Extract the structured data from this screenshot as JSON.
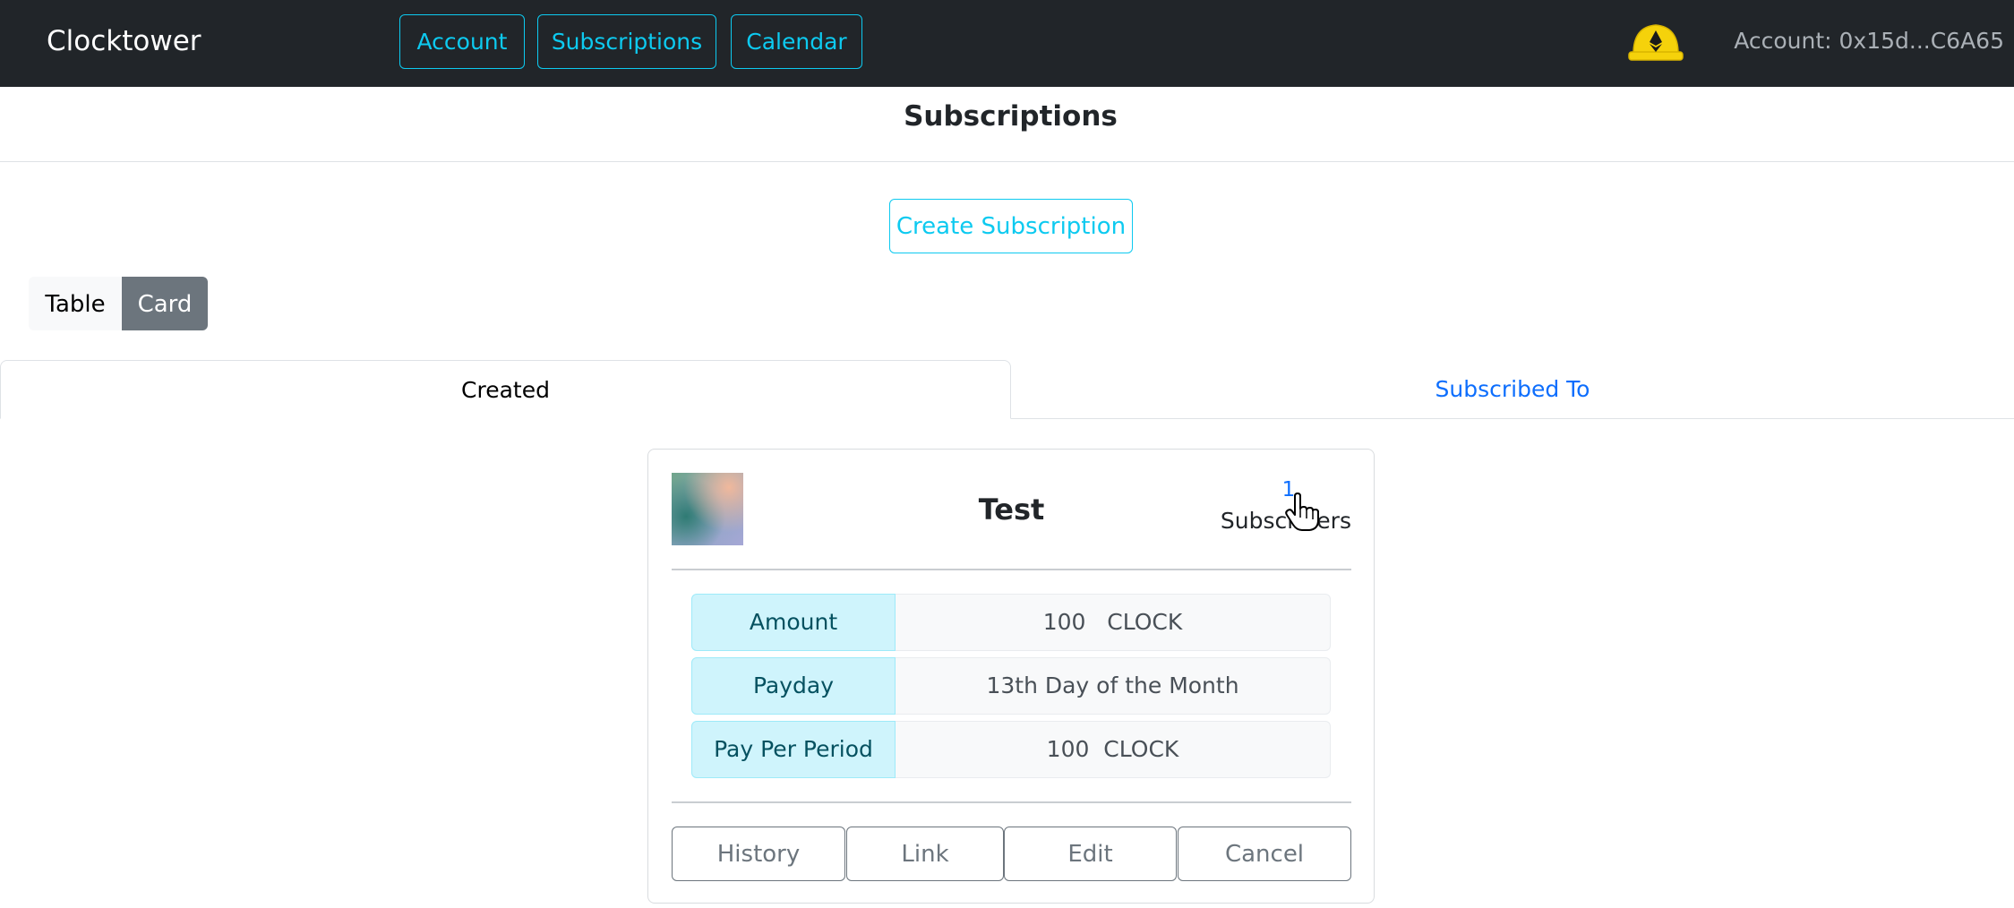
{
  "navbar": {
    "brand": "Clocktower",
    "links": {
      "account": "Account",
      "subscriptions": "Subscriptions",
      "calendar": "Calendar"
    },
    "wallet_icon": "ethereum-helmet-icon",
    "account_text": "Account: 0x15d...C6A65"
  },
  "page": {
    "title": "Subscriptions",
    "create_button": "Create Subscription"
  },
  "view_toggle": {
    "table": "Table",
    "card": "Card",
    "selected": "Card"
  },
  "tabs": {
    "created": "Created",
    "subscribed": "Subscribed To",
    "active": "Created"
  },
  "card": {
    "title": "Test",
    "subscriber_count": "1",
    "subscriber_label": "Subscribers",
    "rows": [
      {
        "label": "Amount",
        "value": "100   CLOCK"
      },
      {
        "label": "Payday",
        "value": "13th Day of the Month"
      },
      {
        "label": "Pay Per Period",
        "value": "100  CLOCK"
      }
    ],
    "buttons": {
      "history": "History",
      "link": "Link",
      "edit": "Edit",
      "cancel": "Cancel"
    }
  },
  "colors": {
    "navbar_bg": "#212529",
    "accent_info": "#0dcaf0",
    "link_blue": "#0d6efd",
    "secondary": "#6c757d",
    "info_label_bg": "#cff4fc"
  }
}
